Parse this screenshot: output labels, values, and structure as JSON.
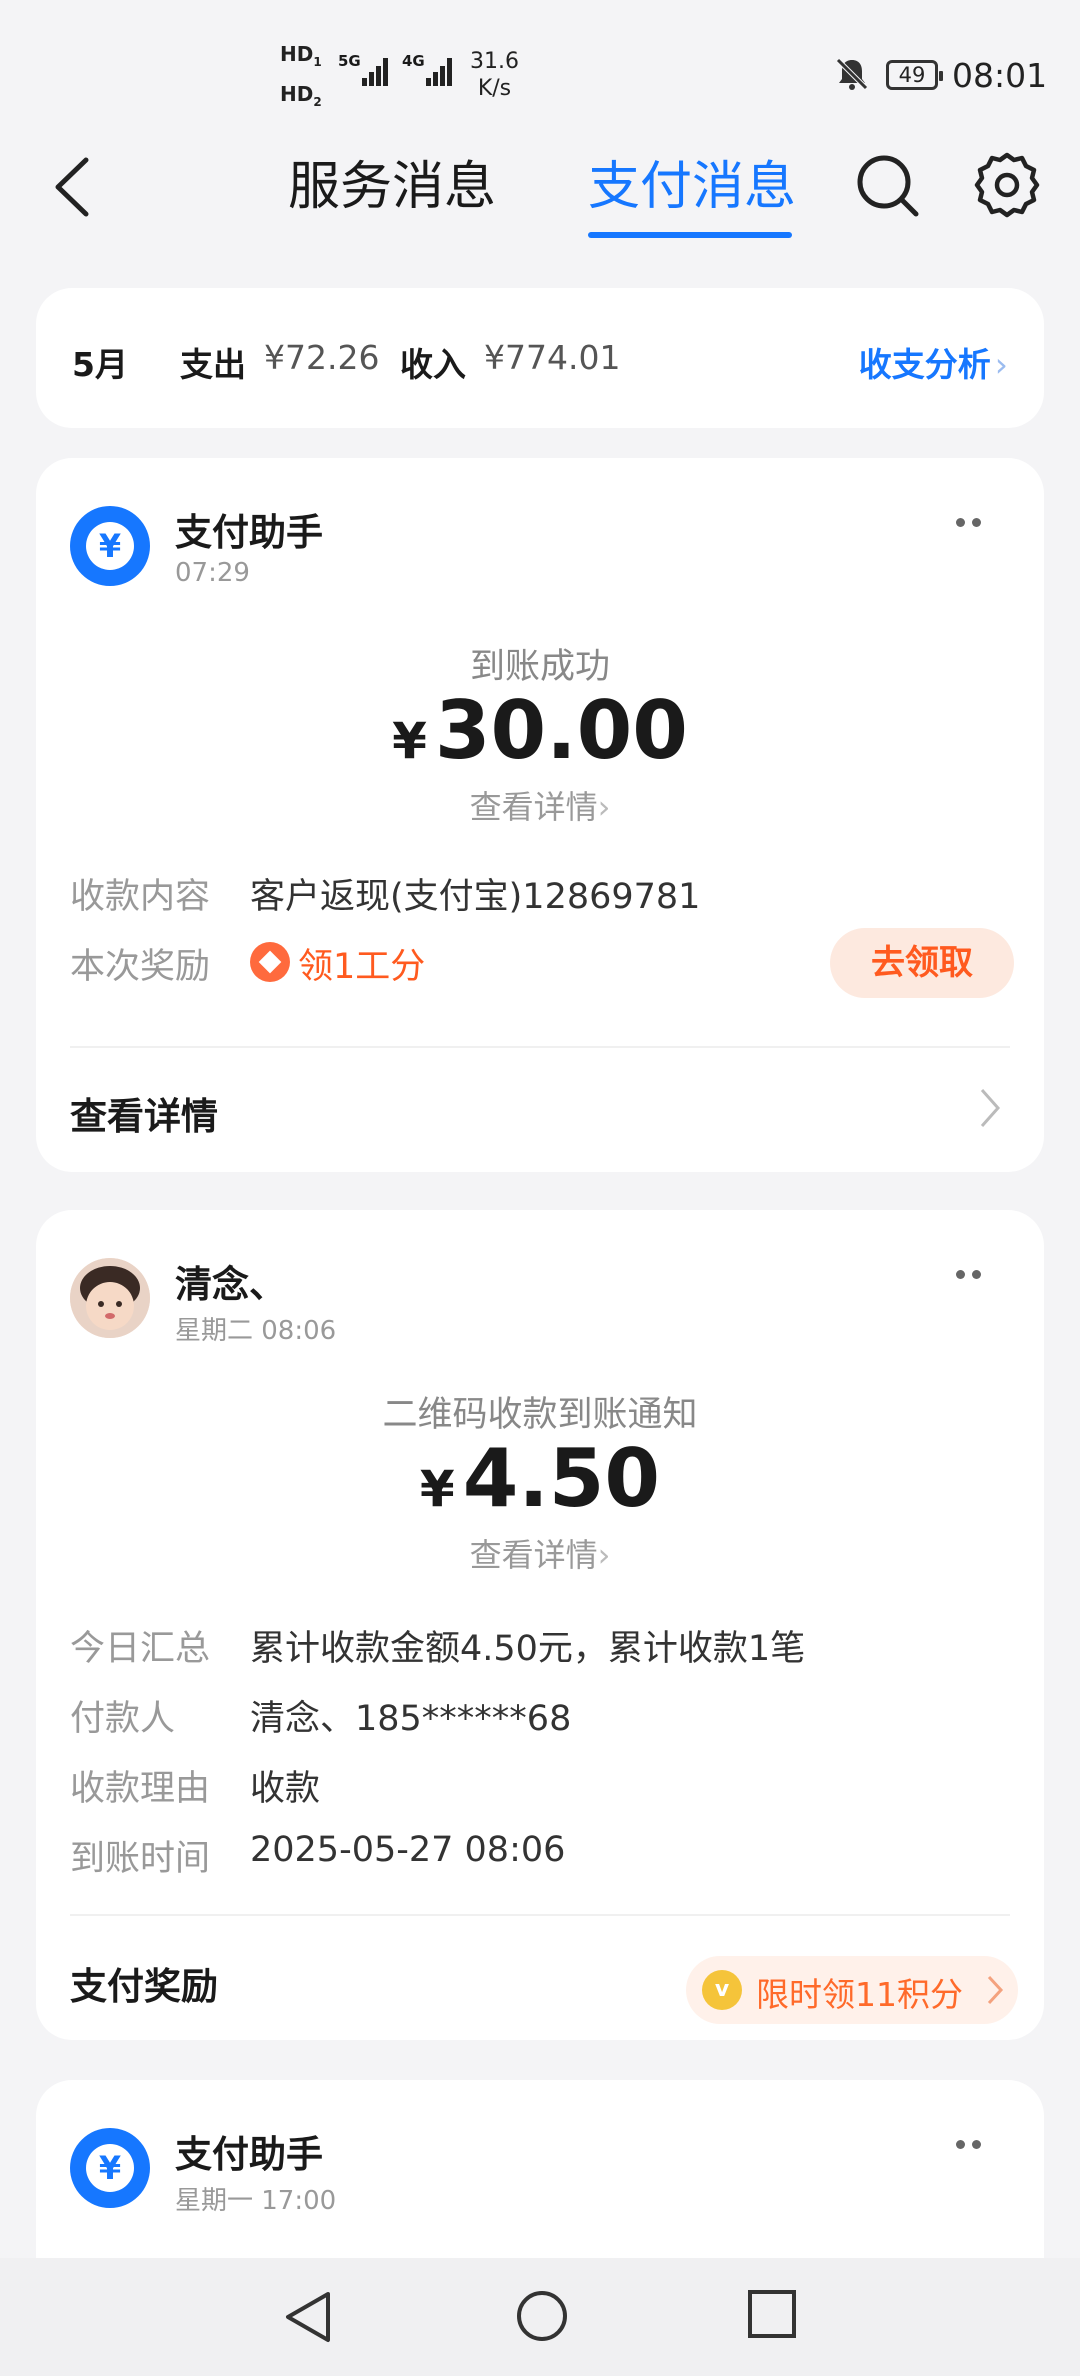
{
  "status_bar": {
    "hd1": "HD",
    "hd1_sub": "1",
    "hd2": "HD",
    "hd2_sub": "2",
    "net1": "5G",
    "net2": "4G",
    "speed_value": "31.6",
    "speed_unit": "K/s",
    "battery": "49",
    "time": "08:01"
  },
  "header": {
    "tab_service": "服务消息",
    "tab_pay": "支付消息",
    "accent": "#1677ff"
  },
  "summary": {
    "month": "5月",
    "expense_label": "支出",
    "expense_value": "¥72.26",
    "income_label": "收入",
    "income_value": "¥774.01",
    "analysis_link": "收支分析"
  },
  "card1": {
    "sender": "支付助手",
    "time": "07:29",
    "title": "到账成功",
    "currency": "¥",
    "amount": "30.00",
    "detail_link": "查看详情",
    "rows": [
      {
        "label": "收款内容",
        "value": "客户返现(支付宝)12869781"
      },
      {
        "label": "本次奖励",
        "value": "领1工分"
      }
    ],
    "claim_button": "去领取",
    "footer": "查看详情"
  },
  "card2": {
    "sender": "清念、",
    "time": "星期二 08:06",
    "title": "二维码收款到账通知",
    "currency": "¥",
    "amount": "4.50",
    "detail_link": "查看详情",
    "rows": [
      {
        "label": "今日汇总",
        "value": "累计收款金额4.50元，累计收款1笔"
      },
      {
        "label": "付款人",
        "value": "清念、185******68"
      },
      {
        "label": "收款理由",
        "value": "收款"
      },
      {
        "label": "到账时间",
        "value": "2025-05-27 08:06"
      }
    ],
    "footer": "支付奖励",
    "bonus_text": "限时领11积分"
  },
  "card3": {
    "sender": "支付助手",
    "time": "星期一 17:00"
  },
  "icons": [
    "back-icon",
    "search-icon",
    "gear-icon",
    "bell-muted-icon",
    "more-icon",
    "chevron-right-icon",
    "nav-back-icon",
    "nav-home-icon",
    "nav-recents-icon"
  ]
}
